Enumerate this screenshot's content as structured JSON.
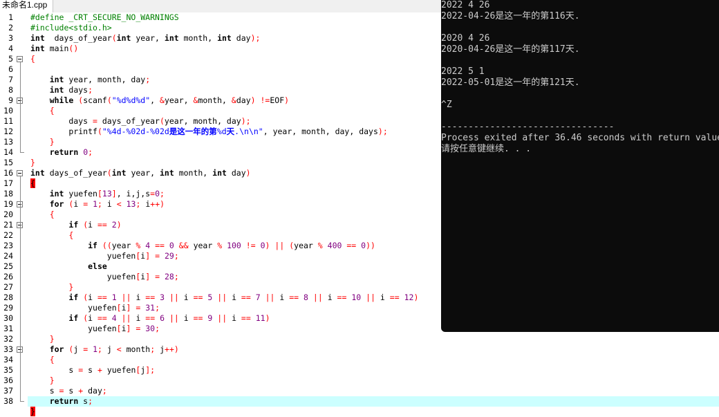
{
  "tab": {
    "label": "未命名1.cpp"
  },
  "editor": {
    "line_numbers": [
      "1",
      "2",
      "3",
      "4",
      "5",
      "6",
      "7",
      "8",
      "9",
      "10",
      "11",
      "12",
      "13",
      "14",
      "15",
      "16",
      "17",
      "18",
      "19",
      "20",
      "21",
      "22",
      "23",
      "24",
      "25",
      "26",
      "27",
      "28",
      "29",
      "30",
      "31",
      "32",
      "33",
      "34",
      "35",
      "36",
      "37",
      "38"
    ],
    "fold_lines": [
      5,
      9,
      16,
      19,
      21,
      33
    ],
    "active_line": 38,
    "code_lines": [
      [
        [
          "pp",
          "#define _CRT_SECURE_NO_WARNINGS"
        ]
      ],
      [
        [
          "pp",
          "#include<stdio.h>"
        ]
      ],
      [
        [
          "kw",
          "int"
        ],
        [
          "",
          "  days_of_year"
        ],
        [
          "op",
          "("
        ],
        [
          "kw",
          "int"
        ],
        [
          "",
          " year, "
        ],
        [
          "kw",
          "int"
        ],
        [
          "",
          " month, "
        ],
        [
          "kw",
          "int"
        ],
        [
          "",
          " day"
        ],
        [
          "op",
          ");"
        ]
      ],
      [
        [
          "kw",
          "int"
        ],
        [
          "",
          " main"
        ],
        [
          "op",
          "()"
        ]
      ],
      [
        [
          "brkt",
          "{"
        ]
      ],
      [
        [
          "",
          ""
        ]
      ],
      [
        [
          "",
          "    "
        ],
        [
          "kw",
          "int"
        ],
        [
          "",
          " year, month, day"
        ],
        [
          "op",
          ";"
        ]
      ],
      [
        [
          "",
          "    "
        ],
        [
          "kw",
          "int"
        ],
        [
          "",
          " days"
        ],
        [
          "op",
          ";"
        ]
      ],
      [
        [
          "",
          "    "
        ],
        [
          "kw",
          "while"
        ],
        [
          "",
          " "
        ],
        [
          "op",
          "("
        ],
        [
          "",
          "scanf"
        ],
        [
          "op",
          "("
        ],
        [
          "str",
          "\"%d%d%d\""
        ],
        [
          "",
          ", "
        ],
        [
          "op",
          "&"
        ],
        [
          "",
          "year, "
        ],
        [
          "op",
          "&"
        ],
        [
          "",
          "month, "
        ],
        [
          "op",
          "&"
        ],
        [
          "",
          "day"
        ],
        [
          "op",
          ")"
        ],
        [
          "",
          " "
        ],
        [
          "op",
          "!="
        ],
        [
          "",
          "EOF"
        ],
        [
          "op",
          ")"
        ]
      ],
      [
        [
          "",
          "    "
        ],
        [
          "brkt",
          "{"
        ]
      ],
      [
        [
          "",
          "        days "
        ],
        [
          "op",
          "="
        ],
        [
          "",
          " days_of_year"
        ],
        [
          "op",
          "("
        ],
        [
          "",
          "year, month, day"
        ],
        [
          "op",
          ");"
        ]
      ],
      [
        [
          "",
          "        printf"
        ],
        [
          "op",
          "("
        ],
        [
          "str",
          "\"%4d-%02d-%02d"
        ],
        [
          "strb",
          "是这一年的第"
        ],
        [
          "str",
          "%d"
        ],
        [
          "strb",
          "天"
        ],
        [
          "str",
          ".\\n\\n\""
        ],
        [
          "",
          ", year, month, day, days"
        ],
        [
          "op",
          ");"
        ]
      ],
      [
        [
          "",
          "    "
        ],
        [
          "brkt",
          "}"
        ]
      ],
      [
        [
          "",
          "    "
        ],
        [
          "kw",
          "return"
        ],
        [
          "",
          " "
        ],
        [
          "num",
          "0"
        ],
        [
          "op",
          ";"
        ]
      ],
      [
        [
          "brkt",
          "}"
        ]
      ],
      [
        [
          "kw",
          "int"
        ],
        [
          "",
          " days_of_year"
        ],
        [
          "op",
          "("
        ],
        [
          "kw",
          "int"
        ],
        [
          "",
          " year, "
        ],
        [
          "kw",
          "int"
        ],
        [
          "",
          " month, "
        ],
        [
          "kw",
          "int"
        ],
        [
          "",
          " day"
        ],
        [
          "op",
          ")"
        ]
      ],
      [
        [
          "hl",
          "{"
        ]
      ],
      [
        [
          "",
          "    "
        ],
        [
          "kw",
          "int"
        ],
        [
          "",
          " yuefen"
        ],
        [
          "op",
          "["
        ],
        [
          "num",
          "13"
        ],
        [
          "op",
          "]"
        ],
        [
          "",
          ", i,j,s"
        ],
        [
          "op",
          "="
        ],
        [
          "num",
          "0"
        ],
        [
          "op",
          ";"
        ]
      ],
      [
        [
          "",
          "    "
        ],
        [
          "kw",
          "for"
        ],
        [
          "",
          " "
        ],
        [
          "op",
          "("
        ],
        [
          "",
          "i "
        ],
        [
          "op",
          "="
        ],
        [
          "",
          " "
        ],
        [
          "num",
          "1"
        ],
        [
          "op",
          ";"
        ],
        [
          "",
          " i "
        ],
        [
          "op",
          "<"
        ],
        [
          "",
          " "
        ],
        [
          "num",
          "13"
        ],
        [
          "op",
          ";"
        ],
        [
          "",
          " i"
        ],
        [
          "op",
          "++)"
        ]
      ],
      [
        [
          "",
          "    "
        ],
        [
          "brkt",
          "{"
        ]
      ],
      [
        [
          "",
          "        "
        ],
        [
          "kw",
          "if"
        ],
        [
          "",
          " "
        ],
        [
          "op",
          "("
        ],
        [
          "",
          "i "
        ],
        [
          "op",
          "=="
        ],
        [
          "",
          " "
        ],
        [
          "num",
          "2"
        ],
        [
          "op",
          ")"
        ]
      ],
      [
        [
          "",
          "        "
        ],
        [
          "brkt",
          "{"
        ]
      ],
      [
        [
          "",
          "            "
        ],
        [
          "kw",
          "if"
        ],
        [
          "",
          " "
        ],
        [
          "op",
          "(("
        ],
        [
          "",
          "year "
        ],
        [
          "op",
          "%"
        ],
        [
          "",
          " "
        ],
        [
          "num",
          "4"
        ],
        [
          "",
          " "
        ],
        [
          "op",
          "=="
        ],
        [
          "",
          " "
        ],
        [
          "num",
          "0"
        ],
        [
          "",
          " "
        ],
        [
          "op",
          "&&"
        ],
        [
          "",
          " year "
        ],
        [
          "op",
          "%"
        ],
        [
          "",
          " "
        ],
        [
          "num",
          "100"
        ],
        [
          "",
          " "
        ],
        [
          "op",
          "!="
        ],
        [
          "",
          " "
        ],
        [
          "num",
          "0"
        ],
        [
          "op",
          ")"
        ],
        [
          "",
          " "
        ],
        [
          "op",
          "||"
        ],
        [
          "",
          " "
        ],
        [
          "op",
          "("
        ],
        [
          "",
          "year "
        ],
        [
          "op",
          "%"
        ],
        [
          "",
          " "
        ],
        [
          "num",
          "400"
        ],
        [
          "",
          " "
        ],
        [
          "op",
          "=="
        ],
        [
          "",
          " "
        ],
        [
          "num",
          "0"
        ],
        [
          "op",
          "))"
        ]
      ],
      [
        [
          "",
          "                yuefen"
        ],
        [
          "op",
          "["
        ],
        [
          "",
          "i"
        ],
        [
          "op",
          "]"
        ],
        [
          "",
          " "
        ],
        [
          "op",
          "="
        ],
        [
          "",
          " "
        ],
        [
          "num",
          "29"
        ],
        [
          "op",
          ";"
        ]
      ],
      [
        [
          "",
          "            "
        ],
        [
          "kw",
          "else"
        ]
      ],
      [
        [
          "",
          "                yuefen"
        ],
        [
          "op",
          "["
        ],
        [
          "",
          "i"
        ],
        [
          "op",
          "]"
        ],
        [
          "",
          " "
        ],
        [
          "op",
          "="
        ],
        [
          "",
          " "
        ],
        [
          "num",
          "28"
        ],
        [
          "op",
          ";"
        ]
      ],
      [
        [
          "",
          "        "
        ],
        [
          "brkt",
          "}"
        ]
      ],
      [
        [
          "",
          "        "
        ],
        [
          "kw",
          "if"
        ],
        [
          "",
          " "
        ],
        [
          "op",
          "("
        ],
        [
          "",
          "i "
        ],
        [
          "op",
          "=="
        ],
        [
          "",
          " "
        ],
        [
          "num",
          "1"
        ],
        [
          "",
          " "
        ],
        [
          "op",
          "||"
        ],
        [
          "",
          " i "
        ],
        [
          "op",
          "=="
        ],
        [
          "",
          " "
        ],
        [
          "num",
          "3"
        ],
        [
          "",
          " "
        ],
        [
          "op",
          "||"
        ],
        [
          "",
          " i "
        ],
        [
          "op",
          "=="
        ],
        [
          "",
          " "
        ],
        [
          "num",
          "5"
        ],
        [
          "",
          " "
        ],
        [
          "op",
          "||"
        ],
        [
          "",
          " i "
        ],
        [
          "op",
          "=="
        ],
        [
          "",
          " "
        ],
        [
          "num",
          "7"
        ],
        [
          "",
          " "
        ],
        [
          "op",
          "||"
        ],
        [
          "",
          " i "
        ],
        [
          "op",
          "=="
        ],
        [
          "",
          " "
        ],
        [
          "num",
          "8"
        ],
        [
          "",
          " "
        ],
        [
          "op",
          "||"
        ],
        [
          "",
          " i "
        ],
        [
          "op",
          "=="
        ],
        [
          "",
          " "
        ],
        [
          "num",
          "10"
        ],
        [
          "",
          " "
        ],
        [
          "op",
          "||"
        ],
        [
          "",
          " i "
        ],
        [
          "op",
          "=="
        ],
        [
          "",
          " "
        ],
        [
          "num",
          "12"
        ],
        [
          "op",
          ")"
        ]
      ],
      [
        [
          "",
          "            yuefen"
        ],
        [
          "op",
          "["
        ],
        [
          "",
          "i"
        ],
        [
          "op",
          "]"
        ],
        [
          "",
          " "
        ],
        [
          "op",
          "="
        ],
        [
          "",
          " "
        ],
        [
          "num",
          "31"
        ],
        [
          "op",
          ";"
        ]
      ],
      [
        [
          "",
          "        "
        ],
        [
          "kw",
          "if"
        ],
        [
          "",
          " "
        ],
        [
          "op",
          "("
        ],
        [
          "",
          "i "
        ],
        [
          "op",
          "=="
        ],
        [
          "",
          " "
        ],
        [
          "num",
          "4"
        ],
        [
          "",
          " "
        ],
        [
          "op",
          "||"
        ],
        [
          "",
          " i "
        ],
        [
          "op",
          "=="
        ],
        [
          "",
          " "
        ],
        [
          "num",
          "6"
        ],
        [
          "",
          " "
        ],
        [
          "op",
          "||"
        ],
        [
          "",
          " i "
        ],
        [
          "op",
          "=="
        ],
        [
          "",
          " "
        ],
        [
          "num",
          "9"
        ],
        [
          "",
          " "
        ],
        [
          "op",
          "||"
        ],
        [
          "",
          " i "
        ],
        [
          "op",
          "=="
        ],
        [
          "",
          " "
        ],
        [
          "num",
          "11"
        ],
        [
          "op",
          ")"
        ]
      ],
      [
        [
          "",
          "            yuefen"
        ],
        [
          "op",
          "["
        ],
        [
          "",
          "i"
        ],
        [
          "op",
          "]"
        ],
        [
          "",
          " "
        ],
        [
          "op",
          "="
        ],
        [
          "",
          " "
        ],
        [
          "num",
          "30"
        ],
        [
          "op",
          ";"
        ]
      ],
      [
        [
          "",
          "    "
        ],
        [
          "brkt",
          "}"
        ]
      ],
      [
        [
          "",
          "    "
        ],
        [
          "kw",
          "for"
        ],
        [
          "",
          " "
        ],
        [
          "op",
          "("
        ],
        [
          "",
          "j "
        ],
        [
          "op",
          "="
        ],
        [
          "",
          " "
        ],
        [
          "num",
          "1"
        ],
        [
          "op",
          ";"
        ],
        [
          "",
          " j "
        ],
        [
          "op",
          "<"
        ],
        [
          "",
          " month"
        ],
        [
          "op",
          ";"
        ],
        [
          "",
          " j"
        ],
        [
          "op",
          "++)"
        ]
      ],
      [
        [
          "",
          "    "
        ],
        [
          "brkt",
          "{"
        ]
      ],
      [
        [
          "",
          "        s "
        ],
        [
          "op",
          "="
        ],
        [
          "",
          " s "
        ],
        [
          "op",
          "+"
        ],
        [
          "",
          " yuefen"
        ],
        [
          "op",
          "["
        ],
        [
          "",
          "j"
        ],
        [
          "op",
          "];"
        ]
      ],
      [
        [
          "",
          "    "
        ],
        [
          "brkt",
          "}"
        ]
      ],
      [
        [
          "",
          "    s "
        ],
        [
          "op",
          "="
        ],
        [
          "",
          " s "
        ],
        [
          "op",
          "+"
        ],
        [
          "",
          " day"
        ],
        [
          "op",
          ";"
        ]
      ],
      [
        [
          "",
          "    "
        ],
        [
          "kw",
          "return"
        ],
        [
          "",
          " s"
        ],
        [
          "op",
          ";"
        ]
      ],
      [
        [
          "hl",
          "}"
        ]
      ]
    ]
  },
  "console": {
    "lines": [
      "2022 4 26",
      "2022-04-26是这一年的第116天.",
      "",
      "2020 4 26",
      "2020-04-26是这一年的第117天.",
      "",
      "2022 5 1",
      "2022-05-01是这一年的第121天.",
      "",
      "^Z",
      "",
      "--------------------------------",
      "Process exited after 36.46 seconds with return value",
      "请按任意键继续. . ."
    ]
  },
  "colors": {
    "active_line_bg": "#ccffff",
    "brace_highlight": "#ff0000",
    "keyword": "#000000",
    "preprocessor": "#008000",
    "string": "#0000ff",
    "number": "#800080",
    "operator": "#ff0000",
    "console_bg": "#0c0c0c",
    "console_text": "#cccccc"
  }
}
